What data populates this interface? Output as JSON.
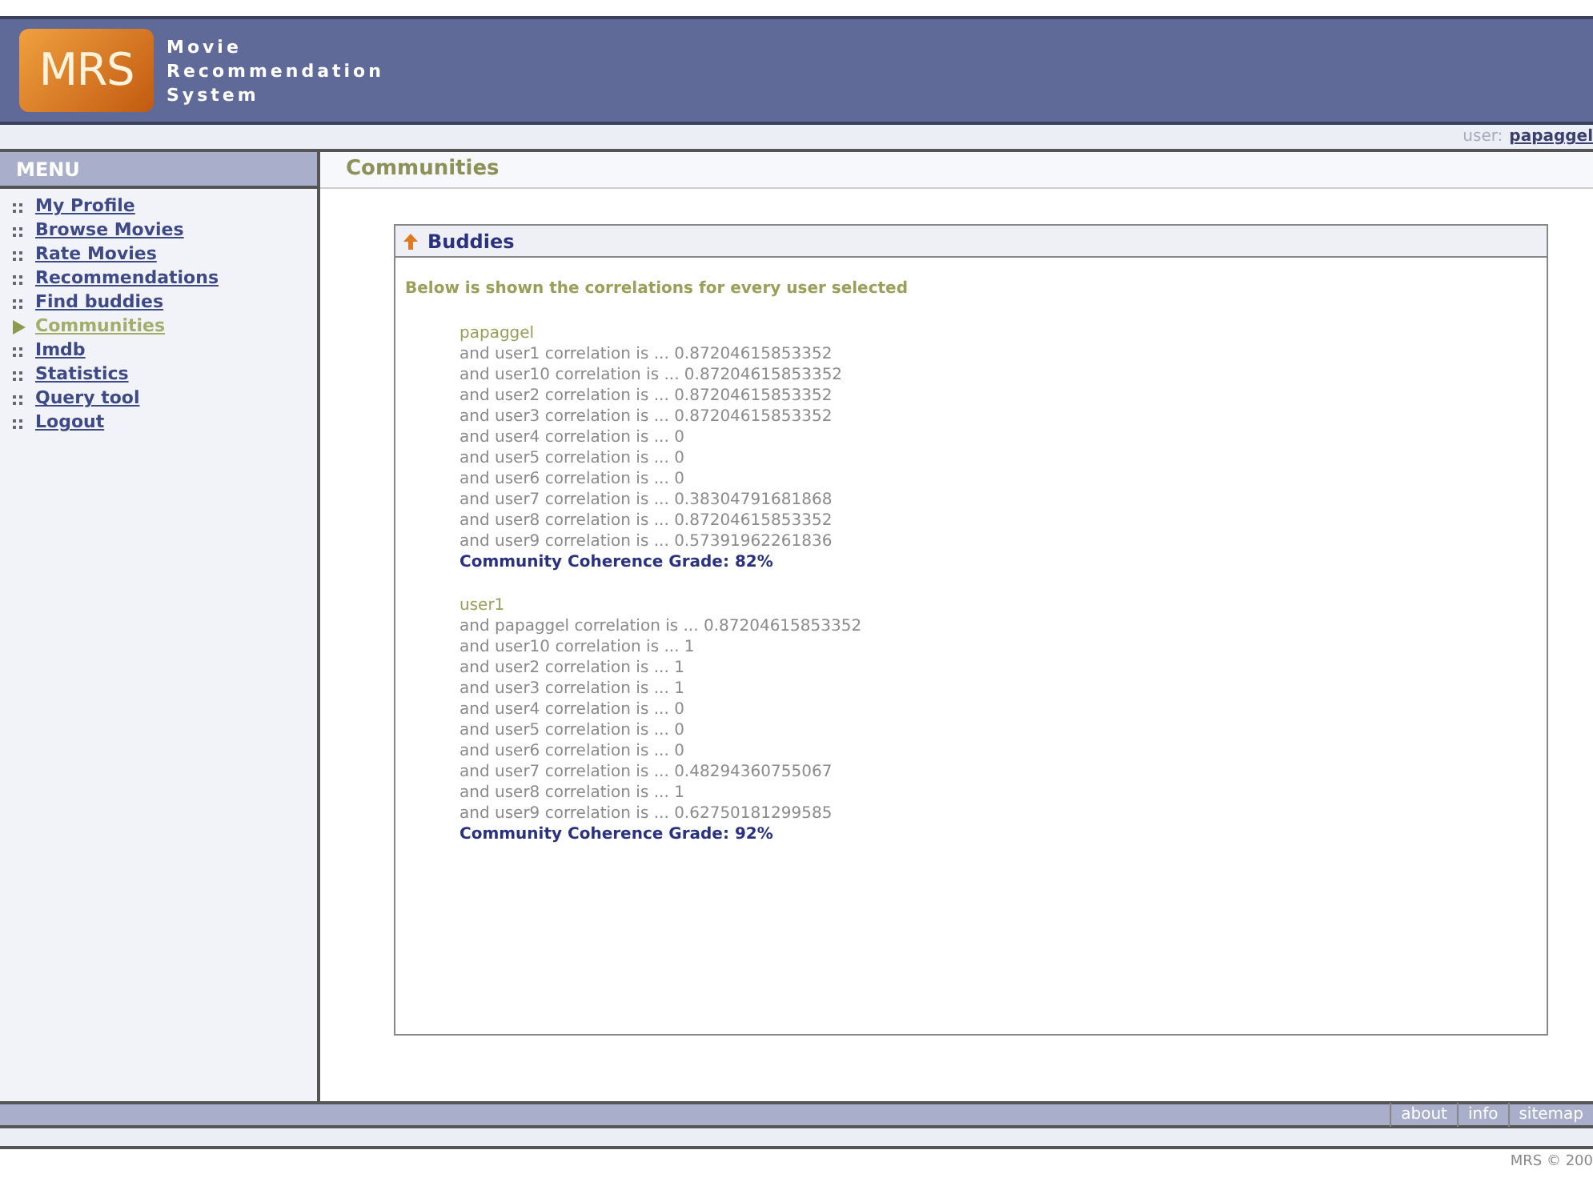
{
  "header": {
    "logo": "MRS",
    "title_lines": [
      "Movie",
      "Recommendation",
      "System"
    ]
  },
  "user_bar": {
    "label": "user:",
    "user": "papaggel"
  },
  "menu": {
    "title": "MENU",
    "items": [
      {
        "label": "My Profile",
        "selected": false
      },
      {
        "label": "Browse Movies",
        "selected": false
      },
      {
        "label": "Rate Movies",
        "selected": false
      },
      {
        "label": "Recommendations",
        "selected": false
      },
      {
        "label": "Find buddies",
        "selected": false
      },
      {
        "label": "Communities",
        "selected": true
      },
      {
        "label": "Imdb",
        "selected": false
      },
      {
        "label": "Statistics",
        "selected": false
      },
      {
        "label": "Query tool",
        "selected": false
      },
      {
        "label": "Logout",
        "selected": false
      }
    ]
  },
  "page_title": "Communities",
  "panel": {
    "title": "Buddies",
    "intro": "Below is shown the correlations for every user selected",
    "groups": [
      {
        "user": "papaggel",
        "lines": [
          "and user1 correlation is ... 0.87204615853352",
          "and user10 correlation is ... 0.87204615853352",
          "and user2 correlation is ... 0.87204615853352",
          "and user3 correlation is ... 0.87204615853352",
          "and user4 correlation is ... 0",
          "and user5 correlation is ... 0",
          "and user6 correlation is ... 0",
          "and user7 correlation is ... 0.38304791681868",
          "and user8 correlation is ... 0.87204615853352",
          "and user9 correlation is ... 0.57391962261836"
        ],
        "grade": "Community Coherence Grade: 82%"
      },
      {
        "user": "user1",
        "lines": [
          "and papaggel correlation is ... 0.87204615853352",
          "and user10 correlation is ... 1",
          "and user2 correlation is ... 1",
          "and user3 correlation is ... 1",
          "and user4 correlation is ... 0",
          "and user5 correlation is ... 0",
          "and user6 correlation is ... 0",
          "and user7 correlation is ... 0.48294360755067",
          "and user8 correlation is ... 1",
          "and user9 correlation is ... 0.62750181299585"
        ],
        "grade": "Community Coherence Grade: 92%"
      }
    ]
  },
  "footer_links": [
    "about",
    "info",
    "sitemap"
  ],
  "copyright": "MRS © 200"
}
